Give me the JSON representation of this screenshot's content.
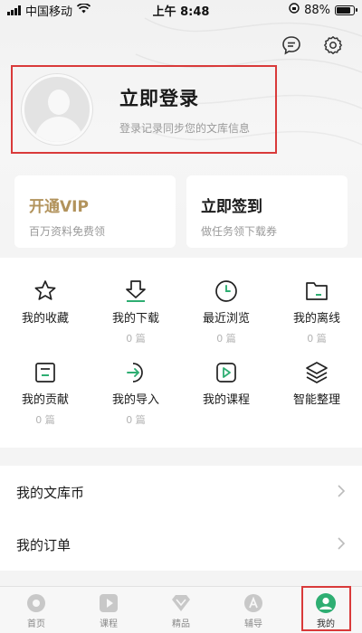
{
  "status_bar": {
    "carrier": "中国移动",
    "time": "上午 8:48",
    "battery": "88%"
  },
  "header": {
    "icons": [
      "message-icon",
      "settings-icon"
    ]
  },
  "login": {
    "title": "立即登录",
    "subtitle": "登录记录同步您的文库信息"
  },
  "cards": {
    "vip": {
      "title": "开通VIP",
      "subtitle": "百万资料免费领"
    },
    "sign": {
      "title": "立即签到",
      "subtitle": "做任务领下载券"
    }
  },
  "grid": [
    {
      "label": "我的收藏",
      "count": "",
      "icon": "star-icon"
    },
    {
      "label": "我的下载",
      "count": "0 篇",
      "icon": "download-icon"
    },
    {
      "label": "最近浏览",
      "count": "0 篇",
      "icon": "clock-icon"
    },
    {
      "label": "我的离线",
      "count": "0 篇",
      "icon": "folder-icon"
    },
    {
      "label": "我的贡献",
      "count": "0 篇",
      "icon": "contribute-icon"
    },
    {
      "label": "我的导入",
      "count": "0 篇",
      "icon": "import-icon"
    },
    {
      "label": "我的课程",
      "count": "",
      "icon": "play-icon"
    },
    {
      "label": "智能整理",
      "count": "",
      "icon": "layers-icon"
    }
  ],
  "list": [
    {
      "label": "我的文库币"
    },
    {
      "label": "我的订单"
    }
  ],
  "tabs": [
    {
      "label": "首页",
      "icon": "home-icon"
    },
    {
      "label": "课程",
      "icon": "course-icon"
    },
    {
      "label": "精品",
      "icon": "diamond-icon"
    },
    {
      "label": "辅导",
      "icon": "tutor-icon"
    },
    {
      "label": "我的",
      "icon": "profile-icon"
    }
  ],
  "colors": {
    "accent_green": "#2eae72",
    "vip_gold": "#b2935c",
    "highlight_red": "#d93a3a"
  }
}
